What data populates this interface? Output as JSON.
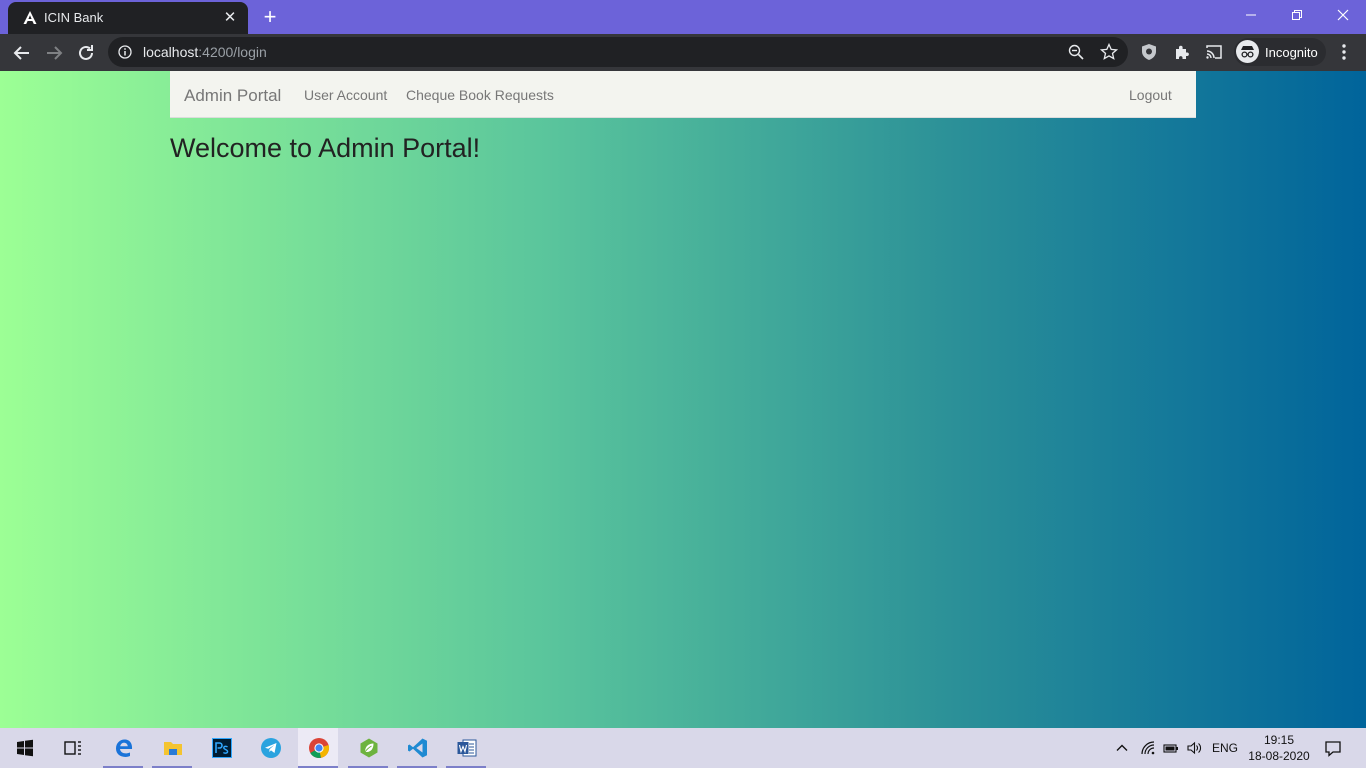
{
  "browser": {
    "tab_title": "ICIN Bank",
    "url_host": "localhost",
    "url_rest": ":4200/login",
    "profile_label": "Incognito"
  },
  "navbar": {
    "brand": "Admin Portal",
    "links": [
      "User Account",
      "Cheque Book Requests"
    ],
    "logout": "Logout"
  },
  "main": {
    "heading": "Welcome to Admin Portal!"
  },
  "taskbar": {
    "language": "ENG",
    "time": "19:15",
    "date": "18-08-2020"
  },
  "colors": {
    "tab_strip": "#6c63d9",
    "gradient_start": "#9cff95",
    "gradient_end": "#00649b"
  }
}
